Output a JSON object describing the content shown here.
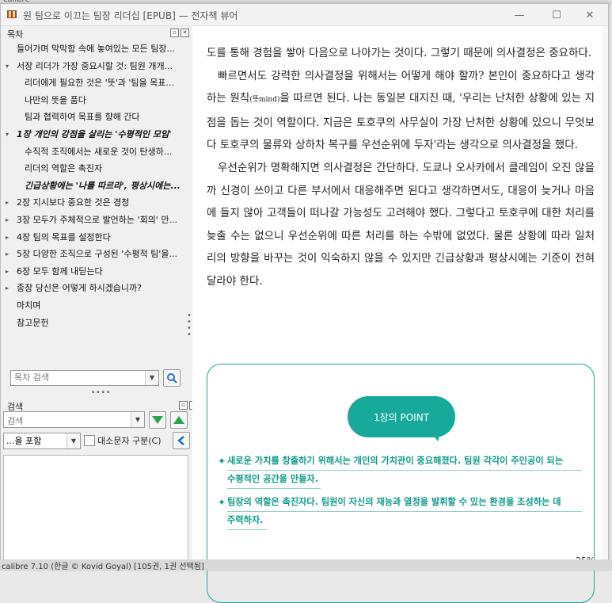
{
  "window": {
    "title": "원 팀으로 이끄는 팀장 리더십 [EPUB] — 전자책 뷰어",
    "min_glyph": "—",
    "max_glyph": "☐",
    "close_glyph": "✕"
  },
  "toc": {
    "heading": "목차",
    "items": [
      {
        "label": "들어가며 막막함 속에 놓여있는 모든 팀장...",
        "level": 0,
        "arrow": "",
        "style": ""
      },
      {
        "label": "서장 리더가 가장 중요시할 것: 팀원 개개...",
        "level": 0,
        "arrow": "▾",
        "style": ""
      },
      {
        "label": "리더에게 필요한 것은 '뜻'과 '팀을 목표...",
        "level": 1,
        "arrow": "",
        "style": ""
      },
      {
        "label": "나만의 뜻을 품다",
        "level": 1,
        "arrow": "",
        "style": ""
      },
      {
        "label": "팀과 협력하여 목표를 향해 간다",
        "level": 1,
        "arrow": "",
        "style": ""
      },
      {
        "label": "1장 개인의 강점을 살리는 '수평적인 모임'",
        "level": 0,
        "arrow": "▾",
        "style": "bold"
      },
      {
        "label": "수직적 조직에서는 새로운 것이 탄생하...",
        "level": 1,
        "arrow": "",
        "style": ""
      },
      {
        "label": "리더의 역할은 촉진자",
        "level": 1,
        "arrow": "",
        "style": ""
      },
      {
        "label": "긴급상황에는 '나를 따르라', 평상시에는...",
        "level": 1,
        "arrow": "",
        "style": "bold"
      },
      {
        "label": "2장 지시보다 중요한 것은 경청",
        "level": 0,
        "arrow": "▸",
        "style": ""
      },
      {
        "label": "3장 모두가 주체적으로 발언하는 '회의' 만...",
        "level": 0,
        "arrow": "▸",
        "style": ""
      },
      {
        "label": "4장 팀의 목표를 설정한다",
        "level": 0,
        "arrow": "▸",
        "style": ""
      },
      {
        "label": "5장 다양한 조직으로 구성된 '수평적 팀'을...",
        "level": 0,
        "arrow": "▸",
        "style": ""
      },
      {
        "label": "6장 모두 함께 내딛는다",
        "level": 0,
        "arrow": "▸",
        "style": ""
      },
      {
        "label": "종장 당신은 어떻게 하시겠습니까?",
        "level": 0,
        "arrow": "▸",
        "style": ""
      },
      {
        "label": "마치며",
        "level": 0,
        "arrow": "",
        "style": ""
      },
      {
        "label": "참고문헌",
        "level": 0,
        "arrow": "",
        "style": ""
      }
    ],
    "search_placeholder": "목차 검색"
  },
  "search": {
    "heading": "검색",
    "placeholder": "검색",
    "mode": "...을 포함",
    "case_label": "대소문자 구분(C)"
  },
  "reader": {
    "paragraphs": [
      {
        "indent": false,
        "html": "도를 통해 경험을 쌓아 다음으로 나아가는 것이다. 그렇기 때문에 의사결정은 중요하다."
      },
      {
        "indent": true,
        "html": "빠르면서도 강력한 의사결정을 위해서는 어떻게 해야 할까? 본인이 중요하다고 생각하는 원칙<small>(뜻mind)</small>을 따르면 된다. 나는 동일본 대지진 때, '우리는 난처한 상황에 있는 지점을 돕는 것이 역할이다. 지금은 토호쿠의 사무실이 가장 난처한 상황에 있으니 무엇보다 토호쿠의 물류와 상하차 복구를 우선순위에 두자'라는 생각으로 의사결정을 했다."
      },
      {
        "indent": true,
        "html": "우선순위가 명확해지면 의사결정은 간단하다. 도쿄나 오사카에서 클레임이 오진 않을까 신경이 쓰이고 다른 부서에서 대응해주면 된다고 생각하면서도, 대응이 늦거나 마음에 들지 않아 고객들이 떠나갈 가능성도 고려해야 했다. 그렇다고 토호쿠에 대한 처리를 늦출 수는 없으니 우선순위에 따른 처리를 하는 수밖에 없었다. 물론 상황에 따라 일처리의 방향을 바꾸는 것이 익숙하지 않을 수 있지만 긴급상황과 평상시에는 기준이 전혀 달라야 한다."
      }
    ],
    "point_title": "1장의 POINT",
    "points": [
      {
        "line1": "새로운 가치를 창출하기 위해서는 개인의 가치관이 중요해졌다. 팀원 각각이 주인공이 되는",
        "line2": "수평적인 공간을 만들자."
      },
      {
        "line1": "팀장의 역할은 촉진자다. 팀원이 자신의 재능과 열정을 발휘할 수 있는 환경을 조성하는 데",
        "line2": "주력하자."
      }
    ],
    "zoom": "25%"
  },
  "background": {
    "top_label": "calibre",
    "status_label": "calibre 7.10 (한글 © Kovid Goyal)     [105권, 1권 선택됨]"
  },
  "colors": {
    "accent": "#17a99a",
    "point_text": "#0f9a89",
    "nav_green": "#22a84a"
  }
}
